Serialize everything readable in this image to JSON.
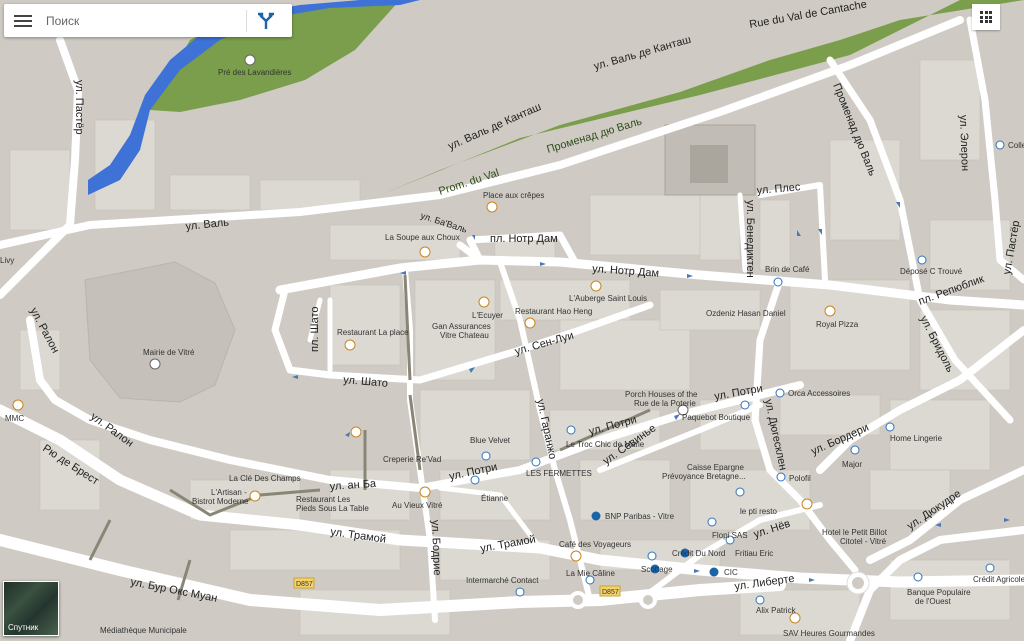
{
  "search": {
    "placeholder": "Поиск"
  },
  "satellite": {
    "label": "Спутник"
  },
  "icons": {
    "menu": "menu-icon",
    "directions": "directions-icon",
    "apps": "apps-grid-icon",
    "satellite": "satellite-thumbnail"
  },
  "colors": {
    "road": "#ffffff",
    "ground": "#cfcbc4",
    "block": "#dcd9d2",
    "park": "#7a9e4b",
    "water": "#3e72d6",
    "poi": "#c9851e",
    "route_badge": "#f3d26a",
    "transit": "#1a64a8"
  },
  "streets": {
    "val_cantache_fr": "Rue du Val de Cantache",
    "val_kantash_ru": "ул. Валь де Канташ",
    "val_kantash_ru2": "ул. Валь де Канташ",
    "promenad_val": "Променад дю Валь",
    "prom_du_val": "Prom. du Val",
    "val": "ул. Валь",
    "paster": "ул. Пастёр",
    "ba_val": "ул. Ба'Валь",
    "notre_dame_sq": "пл. Нотр Дам",
    "notre_dame_st": "ул. Нотр Дам",
    "sen_lui": "ул. Сен-Луи",
    "chateau": "ул. Шато",
    "chateau_sq": "пл. Шато",
    "ralon": "ул. Ралон",
    "ralon2": "ул. Ралон",
    "brest": "Рю де Брест",
    "an_ba": "ул. ан Ба",
    "tramoi": "ул. Трамой",
    "tramoi2": "ул. Трамой",
    "bur_oks_muan": "ул. Бур Окс Муан",
    "bodrie": "ул. Бодрие",
    "garanzho": "ул. Гаранжо",
    "potri": "ул. Потри",
    "potri2": "ул. Потри",
    "potri3": "ул. Потри",
    "sevine": "ул. Севинье",
    "dyugesklen": "ул. Дюгесклен",
    "borderi": "ул. Бордери",
    "nev": "ул. Нёв",
    "diukudre": "ул. Дюкудре",
    "liberte": "ул. Либерте",
    "benediktin": "ул. Бенедиктен",
    "ples": "ул. Плес",
    "promenad_val2": "Променад дю Валь",
    "repiublik": "пл. Репюблик",
    "bridol": "ул. Бридоль",
    "eleron": "ул. Элерон",
    "paster_side": "ул. Пастёр"
  },
  "places": {
    "pre_lavandieres": "Pré des Lavandières",
    "place_crepes": "Place aux crêpes",
    "soupe_choux": "La Soupe aux Choux",
    "lecuyer": "L'Ecuyer",
    "auberge": "L'Auberge Saint Louis",
    "hao_heng": "Restaurant Hao Heng",
    "gan_assurances": "Gan Assurances",
    "vitre_chateau": "Vitre Chateau",
    "restaurant_place": "Restaurant La place",
    "mairie": "Mairie de Vitré",
    "ozdeniz": "Ozdeniz Hasan Daniel",
    "royal_pizza": "Royal Pizza",
    "brin_cafe": "Brin de Café",
    "depose": "Déposé C Trouvé",
    "orca": "Orca Accessoires",
    "porch_houses1": "Porch Houses of the",
    "porch_houses2": "Rue de la Poterie",
    "paquebot": "Paquebot Boutique",
    "home_lingerie": "Home Lingerie",
    "major": "Major",
    "polofil": "Polofil",
    "blue_velvet": "Blue Velvet",
    "troc_chic": "Le Troc Chic de Marie",
    "creperie": "Creperie Re'Vad",
    "les_fermettes": "LES FERMETTES",
    "etianne": "Étianne",
    "caisse_epargne1": "Caisse Epargne",
    "caisse_epargne2": "Prévoyance Bretagne...",
    "cle_champs": "La Clé Des Champs",
    "artisan1": "L'Artisan -",
    "artisan2": "Bistrot Moderne",
    "restaurant_pieds1": "Restaurant Les",
    "restaurant_pieds2": "Pieds Sous La Table",
    "au_vieux_vitre": "Au Vieux Vitré",
    "bnp": "BNP Paribas - Vitre",
    "le_pti_resto": "le pti resto",
    "flopi": "Flopi SAS",
    "hotel_petit_billot1": "Hotel le Petit Billot",
    "hotel_petit_billot2": "Citotel - Vitré",
    "cafe_voyageurs": "Café des Voyageurs",
    "credit_nord": "Crédit Du Nord",
    "fritiau": "Fritiau Eric",
    "scottage": "Scottage",
    "cic": "CIC",
    "intermarche": "Intermarché Contact",
    "mie_caline": "La Mie Câline",
    "alix_patrick": "Alix Patrick",
    "banque_pop1": "Banque Populaire",
    "banque_pop2": "de l'Ouest",
    "credit_agricole": "Crédit Agricole",
    "mediatheque": "Médiathèque Municipale",
    "sav_heures": "SAV Heures Gourmandes",
    "mmc": "MMC",
    "livy": "Livy",
    "colle": "Colle"
  },
  "routes": {
    "d857_a": "D857",
    "d857_b": "D857"
  }
}
